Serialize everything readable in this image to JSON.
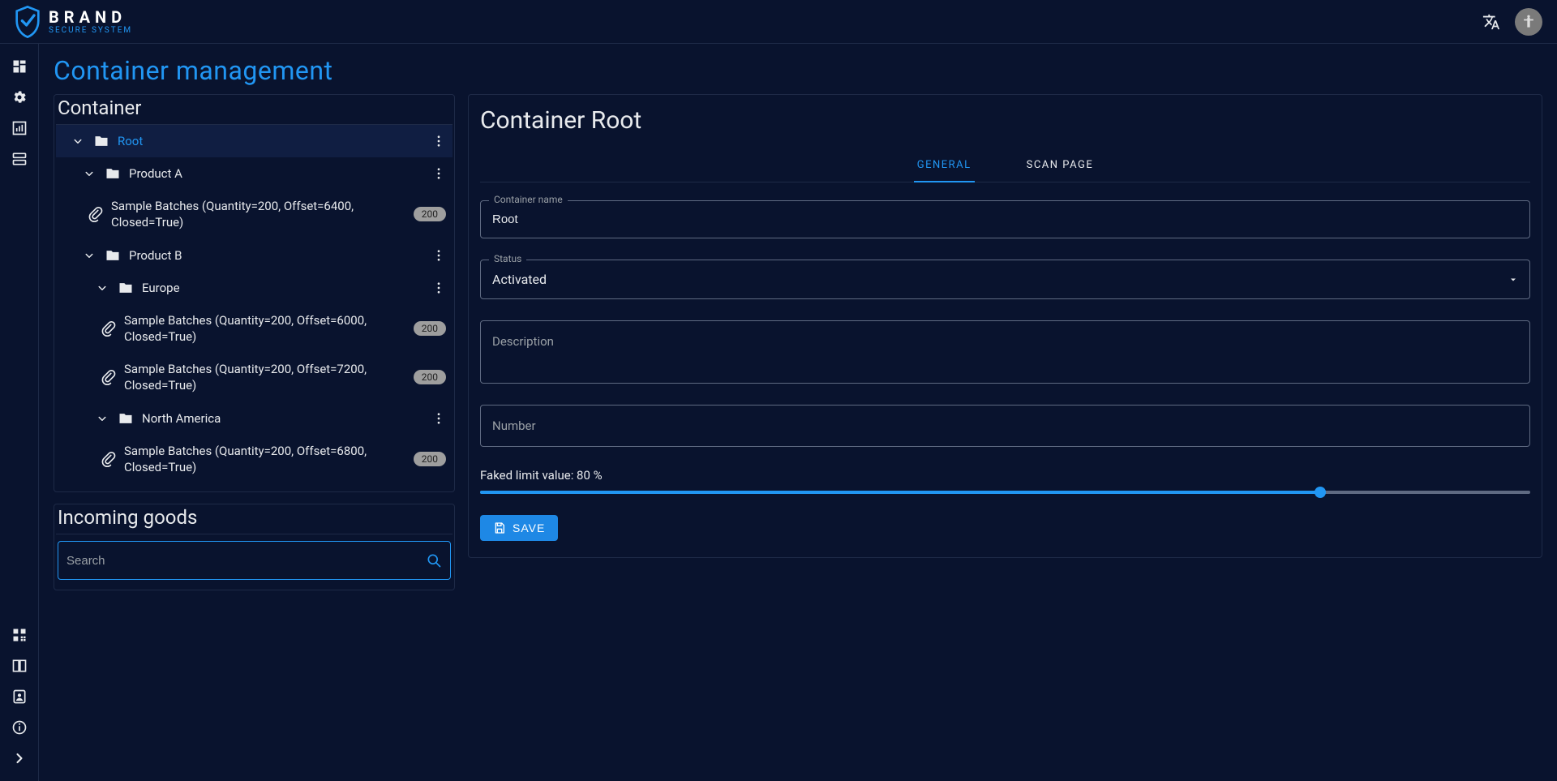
{
  "brand": {
    "name": "BRAND",
    "sub": "SECURE SYSTEM"
  },
  "page": {
    "title": "Container management"
  },
  "containerPanel": {
    "title": "Container",
    "tree": {
      "root": {
        "label": "Root"
      },
      "productA": {
        "label": "Product A"
      },
      "productA_batch": {
        "label": "Sample Batches (Quantity=200, Offset=6400, Closed=True)",
        "badge": "200"
      },
      "productB": {
        "label": "Product B"
      },
      "europe": {
        "label": "Europe"
      },
      "europe_batch1": {
        "label": "Sample Batches (Quantity=200, Offset=6000, Closed=True)",
        "badge": "200"
      },
      "europe_batch2": {
        "label": "Sample Batches (Quantity=200, Offset=7200, Closed=True)",
        "badge": "200"
      },
      "northAmerica": {
        "label": "North America"
      },
      "northAmerica_batch": {
        "label": "Sample Batches (Quantity=200, Offset=6800, Closed=True)",
        "badge": "200"
      }
    }
  },
  "incomingPanel": {
    "title": "Incoming goods",
    "searchPlaceholder": "Search"
  },
  "detail": {
    "title": "Container Root",
    "tabs": {
      "general": "GENERAL",
      "scan": "SCAN PAGE"
    },
    "fields": {
      "containerName": {
        "label": "Container name",
        "value": "Root"
      },
      "status": {
        "label": "Status",
        "value": "Activated"
      },
      "description": {
        "label": "Description",
        "value": ""
      },
      "number": {
        "label": "Number",
        "value": ""
      }
    },
    "slider": {
      "label": "Faked limit value: 80 %",
      "percent": 80
    },
    "saveLabel": "SAVE"
  }
}
